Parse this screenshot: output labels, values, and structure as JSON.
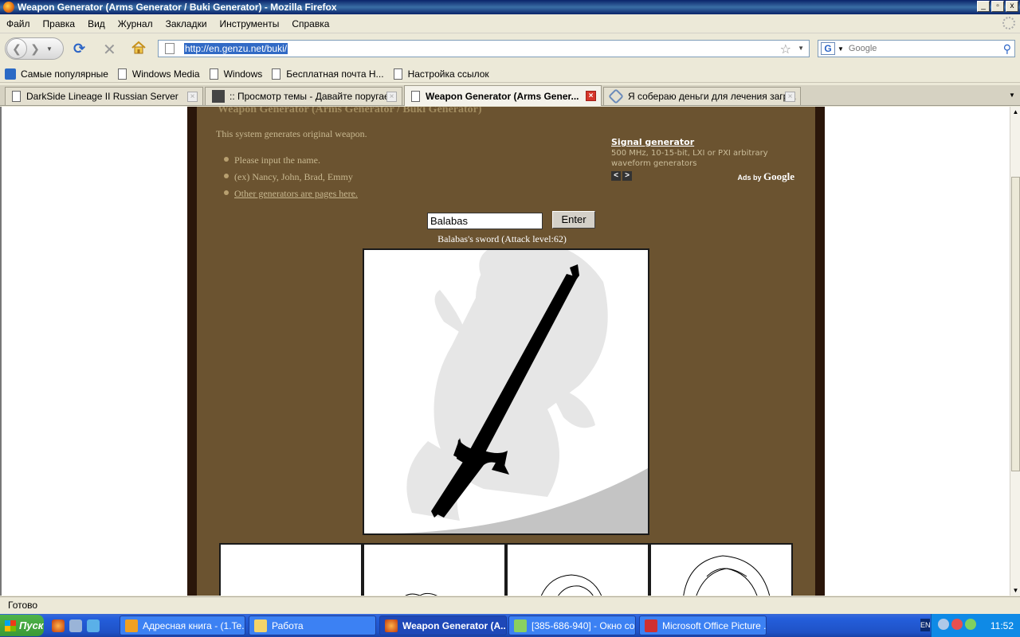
{
  "window": {
    "title": "Weapon Generator (Arms Generator / Buki Generator) - Mozilla Firefox",
    "min": "_",
    "max": "▫",
    "close": "x"
  },
  "menu": [
    "Файл",
    "Правка",
    "Вид",
    "Журнал",
    "Закладки",
    "Инструменты",
    "Справка"
  ],
  "nav": {
    "url": "http://en.genzu.net/buki/",
    "search_placeholder": "Google"
  },
  "bookmarks": [
    "Самые популярные",
    "Windows Media",
    "Windows",
    "Бесплатная почта Н...",
    "Настройка ссылок"
  ],
  "tabs": [
    {
      "label": "DarkSide Lineage II Russian Server"
    },
    {
      "label": ":: Просмотр темы - Давайте поругае..."
    },
    {
      "label": "Weapon Generator (Arms Gener..."
    },
    {
      "label": "Я собераю деньги для лечения загр..."
    }
  ],
  "page": {
    "title": "Weapon Generator (Arms Generator / Buki Generator)",
    "description": "This system generates original weapon.",
    "bullets": [
      "Please input the name.",
      "(ex) Nancy, John, Brad, Emmy",
      "Other generators are pages here."
    ],
    "ad": {
      "title": "Signal generator",
      "text": "500 MHz, 10-15-bit, LXI or PXI arbitrary waveform generators",
      "prev": "<",
      "next": ">",
      "ads_by": "Ads by",
      "google": "Google"
    },
    "input_value": "Balabas",
    "enter_label": "Enter",
    "result": "Balabas's sword (Attack level:62)"
  },
  "status": "Готово",
  "taskbar": {
    "start": "Пуск",
    "tasks": [
      "Адресная книга - (1.Te...",
      "Работа",
      "Weapon Generator (A...",
      "[385-686-940] - Окно со...",
      "Microsoft Office Picture ..."
    ],
    "lang": "EN",
    "time": "11:52"
  }
}
